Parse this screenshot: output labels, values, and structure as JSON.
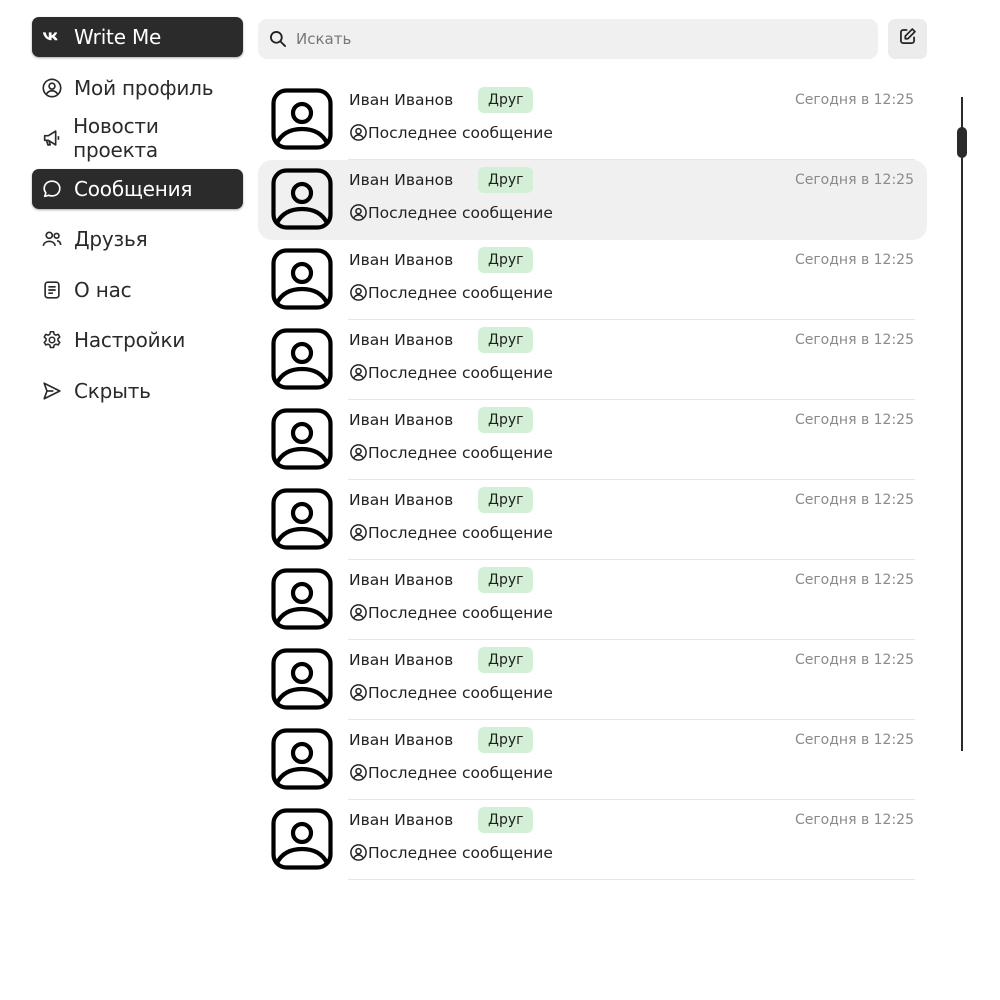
{
  "app": {
    "title": "Write Me"
  },
  "sidebar": {
    "items": [
      {
        "label": "Write Me",
        "icon": "vk-logo-icon",
        "active": true
      },
      {
        "label": "Мой профиль",
        "icon": "user-circle-icon"
      },
      {
        "label": "Новости проекта",
        "icon": "megaphone-icon"
      },
      {
        "label": "Сообщения",
        "icon": "chat-bubble-icon",
        "active": true
      },
      {
        "label": "Друзья",
        "icon": "users-icon"
      },
      {
        "label": "О нас",
        "icon": "document-icon"
      },
      {
        "label": "Настройки",
        "icon": "gear-icon"
      },
      {
        "label": "Скрыть",
        "icon": "send-arrow-icon"
      }
    ]
  },
  "search": {
    "placeholder": "Искать",
    "value": ""
  },
  "compose": {
    "icon": "edit-icon"
  },
  "conversations": [
    {
      "name": "Иван Иванов",
      "badge": "Друг",
      "time": "Сегодня в 12:25",
      "message": "Последнее сообщение"
    },
    {
      "name": "Иван Иванов",
      "badge": "Друг",
      "time": "Сегодня в 12:25",
      "message": "Последнее сообщение",
      "selected": true
    },
    {
      "name": "Иван Иванов",
      "badge": "Друг",
      "time": "Сегодня в 12:25",
      "message": "Последнее сообщение"
    },
    {
      "name": "Иван Иванов",
      "badge": "Друг",
      "time": "Сегодня в 12:25",
      "message": "Последнее сообщение"
    },
    {
      "name": "Иван Иванов",
      "badge": "Друг",
      "time": "Сегодня в 12:25",
      "message": "Последнее сообщение"
    },
    {
      "name": "Иван Иванов",
      "badge": "Друг",
      "time": "Сегодня в 12:25",
      "message": "Последнее сообщение"
    },
    {
      "name": "Иван Иванов",
      "badge": "Друг",
      "time": "Сегодня в 12:25",
      "message": "Последнее сообщение"
    },
    {
      "name": "Иван Иванов",
      "badge": "Друг",
      "time": "Сегодня в 12:25",
      "message": "Последнее сообщение"
    },
    {
      "name": "Иван Иванов",
      "badge": "Друг",
      "time": "Сегодня в 12:25",
      "message": "Последнее сообщение"
    },
    {
      "name": "Иван Иванов",
      "badge": "Друг",
      "time": "Сегодня в 12:25",
      "message": "Последнее сообщение"
    }
  ],
  "colors": {
    "dark": "#2b2b2b",
    "badge_bg": "#d3f0d6",
    "selected_row": "#f0f0f0",
    "search_bg": "#f0f0f0",
    "time_text": "#8a8a8a"
  }
}
